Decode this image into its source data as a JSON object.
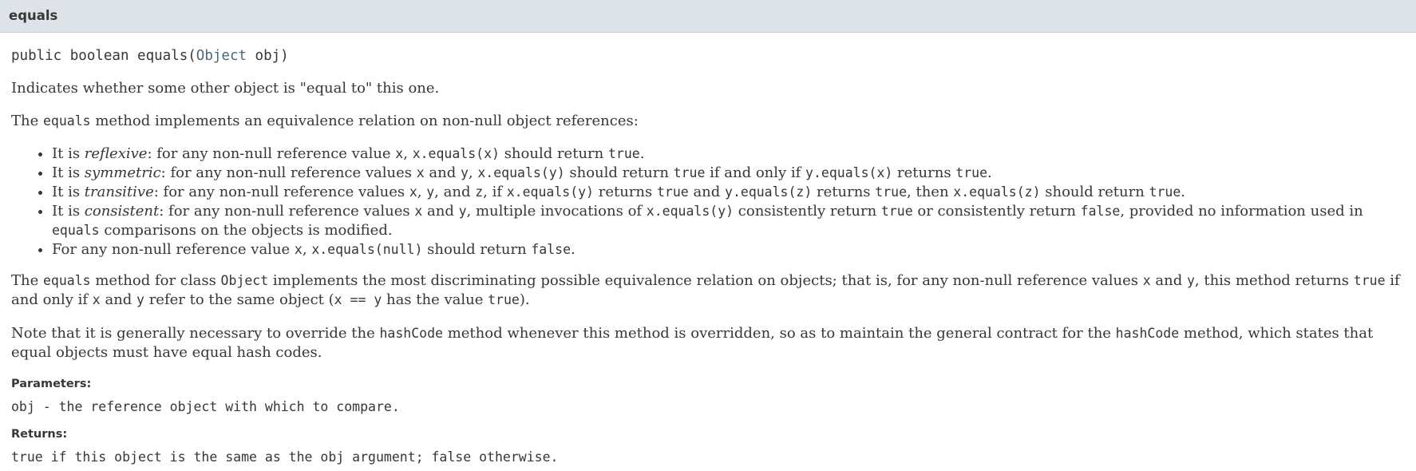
{
  "header": {
    "title": "equals"
  },
  "signature": {
    "modifiers": "public boolean equals(",
    "type_link": "Object",
    "rest": " obj)"
  },
  "desc1": "Indicates whether some other object is \"equal to\" this one.",
  "desc2": {
    "t1": "The ",
    "c1": "equals",
    "t2": " method implements an equivalence relation on non-null object references:"
  },
  "bullets": {
    "reflexive": {
      "t1": "It is ",
      "em": "reflexive",
      "t2": ": for any non-null reference value ",
      "c1": "x",
      "t3": ", ",
      "c2": "x.equals(x)",
      "t4": " should return ",
      "c3": "true",
      "t5": "."
    },
    "symmetric": {
      "t1": "It is ",
      "em": "symmetric",
      "t2": ": for any non-null reference values ",
      "c1": "x",
      "t3": " and ",
      "c2": "y",
      "t4": ", ",
      "c3": "x.equals(y)",
      "t5": " should return ",
      "c4": "true",
      "t6": " if and only if ",
      "c5": "y.equals(x)",
      "t7": " returns ",
      "c6": "true",
      "t8": "."
    },
    "transitive": {
      "t1": "It is ",
      "em": "transitive",
      "t2": ": for any non-null reference values ",
      "c1": "x",
      "t3": ", ",
      "c2": "y",
      "t4": ", and ",
      "c3": "z",
      "t5": ", if ",
      "c4": "x.equals(y)",
      "t6": " returns ",
      "c5": "true",
      "t7": " and ",
      "c6": "y.equals(z)",
      "t8": " returns ",
      "c7": "true",
      "t9": ", then ",
      "c8": "x.equals(z)",
      "t10": " should return ",
      "c9": "true",
      "t11": "."
    },
    "consistent": {
      "t1": "It is ",
      "em": "consistent",
      "t2": ": for any non-null reference values ",
      "c1": "x",
      "t3": " and ",
      "c2": "y",
      "t4": ", multiple invocations of ",
      "c3": "x.equals(y)",
      "t5": " consistently return ",
      "c4": "true",
      "t6": " or consistently return ",
      "c5": "false",
      "t7": ", provided no information used in ",
      "c6": "equals",
      "t8": " comparisons on the objects is modified."
    },
    "null": {
      "t1": "For any non-null reference value ",
      "c1": "x",
      "t2": ", ",
      "c2": "x.equals(null)",
      "t3": " should return ",
      "c3": "false",
      "t4": "."
    }
  },
  "desc3": {
    "t1": "The ",
    "c1": "equals",
    "t2": " method for class ",
    "c2": "Object",
    "t3": " implements the most discriminating possible equivalence relation on objects; that is, for any non-null reference values ",
    "c3": "x",
    "t4": " and ",
    "c4": "y",
    "t5": ", this method returns ",
    "c5": "true",
    "t6": " if and only if ",
    "c6": "x",
    "t7": " and ",
    "c7": "y",
    "t8": " refer to the same object (",
    "c8": "x == y",
    "t9": " has the value ",
    "c9": "true",
    "t10": ")."
  },
  "desc4": {
    "t1": "Note that it is generally necessary to override the ",
    "c1": "hashCode",
    "t2": " method whenever this method is overridden, so as to maintain the general contract for the ",
    "c2": "hashCode",
    "t3": " method, which states that equal objects must have equal hash codes."
  },
  "parameters": {
    "label": "Parameters:",
    "value": "obj - the reference object with which to compare."
  },
  "returns": {
    "label": "Returns:",
    "value": "true if this object is the same as the obj argument; false otherwise."
  }
}
